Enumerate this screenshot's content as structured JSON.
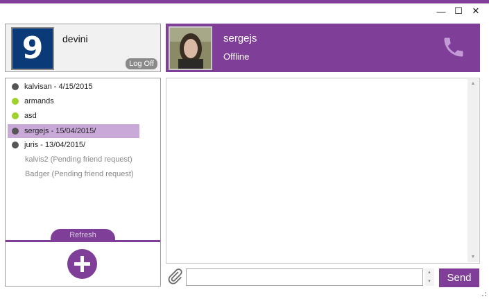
{
  "window": {
    "controls": {
      "minimize": "—",
      "maximize": "☐",
      "close": "✕"
    }
  },
  "current_user": {
    "avatar_text": "9",
    "name": "devini",
    "logoff_label": "Log Off"
  },
  "active_contact": {
    "name": "sergejs",
    "status": "Offline"
  },
  "contacts": [
    {
      "label": "kalvisan - 4/15/2015",
      "status": "offline"
    },
    {
      "label": "armands",
      "status": "online"
    },
    {
      "label": "asd",
      "status": "online"
    },
    {
      "label": "sergejs - 15/04/2015/",
      "status": "offline",
      "selected": true
    },
    {
      "label": "juris - 13/04/2015/",
      "status": "offline"
    },
    {
      "label": "kalvis2 (Pending friend request)",
      "status": "pending"
    },
    {
      "label": "Badger (Pending friend request)",
      "status": "pending"
    }
  ],
  "list_footer": {
    "refresh_label": "Refresh"
  },
  "composer": {
    "message_value": "",
    "send_label": "Send"
  },
  "colors": {
    "accent": "#7f3f98",
    "online": "#9ed12a",
    "offline": "#555555",
    "selected": "#c9a9d8"
  }
}
